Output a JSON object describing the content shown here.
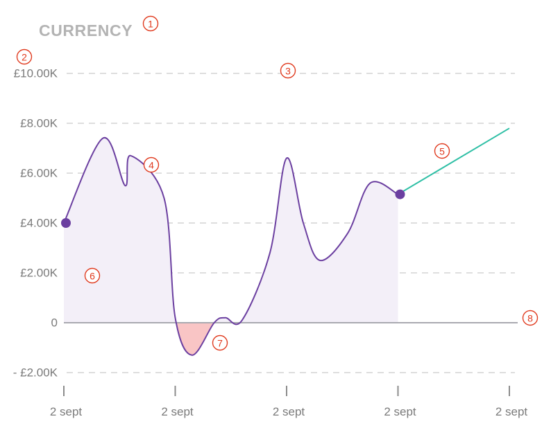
{
  "chart_data": {
    "type": "line",
    "title": "CURRENCY",
    "xlabel": "",
    "ylabel": "",
    "ylim": [
      -2000,
      10000
    ],
    "y_ticks": [
      {
        "value": 10000,
        "label": "£10.00K"
      },
      {
        "value": 8000,
        "label": "£8.00K"
      },
      {
        "value": 6000,
        "label": "£6.00K"
      },
      {
        "value": 4000,
        "label": "£4.00K"
      },
      {
        "value": 2000,
        "label": "£2.00K"
      },
      {
        "value": 0,
        "label": "0"
      },
      {
        "value": -2000,
        "label": "- £2.00K"
      }
    ],
    "x_ticks": [
      "2 sept",
      "2 sept",
      "2 sept",
      "2 sept",
      "2 sept"
    ],
    "grid": "dashed horizontal",
    "series": [
      {
        "kind": "actual",
        "color": "#6b3fa0",
        "fill_positive": "#f3eff8",
        "fill_negative": "#f9c5c5",
        "points": [
          [
            0.0,
            4000
          ],
          [
            0.35,
            7400
          ],
          [
            0.55,
            5500
          ],
          [
            0.6,
            6700
          ],
          [
            0.9,
            5000
          ],
          [
            1.0,
            200
          ],
          [
            1.15,
            -1300
          ],
          [
            1.35,
            0
          ],
          [
            1.45,
            200
          ],
          [
            1.6,
            100
          ],
          [
            1.85,
            2800
          ],
          [
            2.0,
            6600
          ],
          [
            2.15,
            4000
          ],
          [
            2.3,
            2500
          ],
          [
            2.55,
            3600
          ],
          [
            2.75,
            5600
          ],
          [
            3.0,
            5150
          ]
        ]
      },
      {
        "kind": "projection",
        "color": "#2ebfa5",
        "points": [
          [
            3.0,
            5150
          ],
          [
            4.0,
            7800
          ]
        ]
      }
    ],
    "markers": [
      {
        "x": 0.0,
        "y": 4000
      },
      {
        "x": 3.0,
        "y": 5150
      }
    ],
    "callouts": [
      "1",
      "2",
      "3",
      "4",
      "5",
      "6",
      "7",
      "8"
    ]
  }
}
